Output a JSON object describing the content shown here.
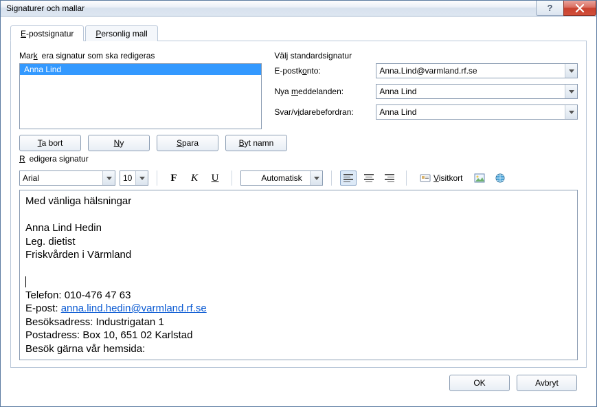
{
  "window": {
    "title": "Signaturer och mallar"
  },
  "tabs": {
    "email": "E-postsignatur",
    "personal": "Personlig mall"
  },
  "left": {
    "group": "Markera signatur som ska redigeras",
    "items": [
      "Anna Lind"
    ],
    "btn_delete": "Ta bort",
    "btn_new": "Ny",
    "btn_save": "Spara",
    "btn_rename": "Byt namn"
  },
  "right": {
    "group": "Välj standardsignatur",
    "account_label": "E-postkonto:",
    "account_value": "Anna.Lind@varmland.rf.se",
    "newmsg_label": "Nya meddelanden:",
    "newmsg_value": "Anna Lind",
    "reply_label": "Svar/vidarebefordran:",
    "reply_value": "Anna Lind"
  },
  "edit": {
    "group": "Redigera signatur",
    "font": "Arial",
    "size": "10",
    "bold": "F",
    "italic": "K",
    "underline": "U",
    "color": "Automatisk",
    "vcard": "Visitkort",
    "body_line1": "Med vänliga hälsningar",
    "body_line2": "Anna Lind Hedin",
    "body_line3": "Leg. dietist",
    "body_line4": "Friskvården i Värmland",
    "body_line6": "Telefon: 010-476 47 63",
    "body_line7a": "E-post: ",
    "body_line7b": "anna.lind.hedin@varmland.rf.se",
    "body_line8": "Besöksadress: Industrigatan 1",
    "body_line9": "Postadress: Box 10, 651 02 Karlstad",
    "body_line10": "Besök gärna vår hemsida:"
  },
  "footer": {
    "ok": "OK",
    "cancel": "Avbryt"
  }
}
